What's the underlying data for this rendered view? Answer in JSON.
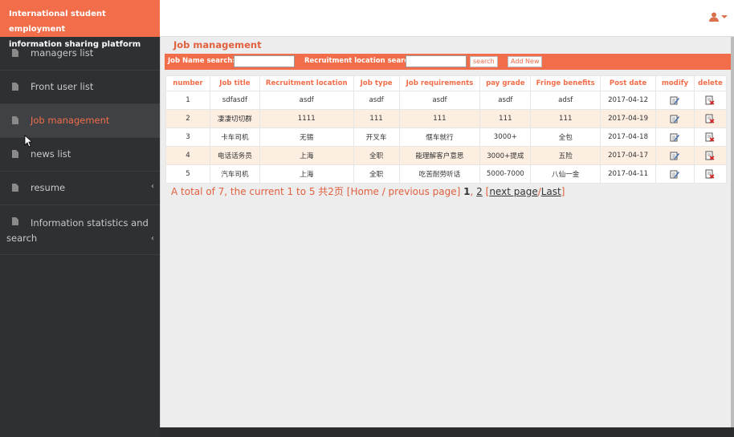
{
  "brand": {
    "line1": "International student employment",
    "line2": "information sharing platform"
  },
  "sidebar": {
    "items": [
      {
        "label": "managers list"
      },
      {
        "label": "Front user list"
      },
      {
        "label": "Job management"
      },
      {
        "label": "news list"
      },
      {
        "label": "resume"
      },
      {
        "label": "Information statistics and search"
      }
    ]
  },
  "topbar": {
    "user_icon": "user-icon"
  },
  "page": {
    "title": "Job management"
  },
  "search": {
    "job_name_label": "Job Name search:",
    "job_name_value": "",
    "location_label": "Recruitment location search:",
    "location_value": "",
    "search_button": "search",
    "add_button": "Add New"
  },
  "table": {
    "headers": [
      "number",
      "Job title",
      "Recruitment location",
      "Job type",
      "Job requirements",
      "pay grade",
      "Fringe benefits",
      "Post date",
      "modify",
      "delete"
    ],
    "rows": [
      [
        "1",
        "sdfasdf",
        "asdf",
        "asdf",
        "asdf",
        "asdf",
        "adsf",
        "2017-04-12"
      ],
      [
        "2",
        "凄凄切切群",
        "1111",
        "111",
        "111",
        "111",
        "111",
        "2017-04-19"
      ],
      [
        "3",
        "卡车司机",
        "无锡",
        "开叉车",
        "惬车就行",
        "3000+",
        "全包",
        "2017-04-18"
      ],
      [
        "4",
        "电话话务员",
        "上海",
        "全职",
        "能理解客户意思",
        "3000+提成",
        "五险",
        "2017-04-17"
      ],
      [
        "5",
        "汽车司机",
        "上海",
        "全职",
        "吃苦耐劳听话",
        "5000-7000",
        "八仙一金",
        "2017-04-11"
      ]
    ]
  },
  "pager": {
    "summary": "A total of 7, the current 1 to 5 共2页",
    "first_prev": "[Home / previous page]",
    "page1": "1",
    "sep": ",",
    "page2": "2",
    "bracket_open": "[",
    "next": "next page",
    "slash": "/",
    "last": "Last",
    "bracket_close": "]"
  },
  "colors": {
    "accent": "#f26e4b",
    "sidebar": "#2e3033",
    "row_alt": "#fdeee2"
  }
}
